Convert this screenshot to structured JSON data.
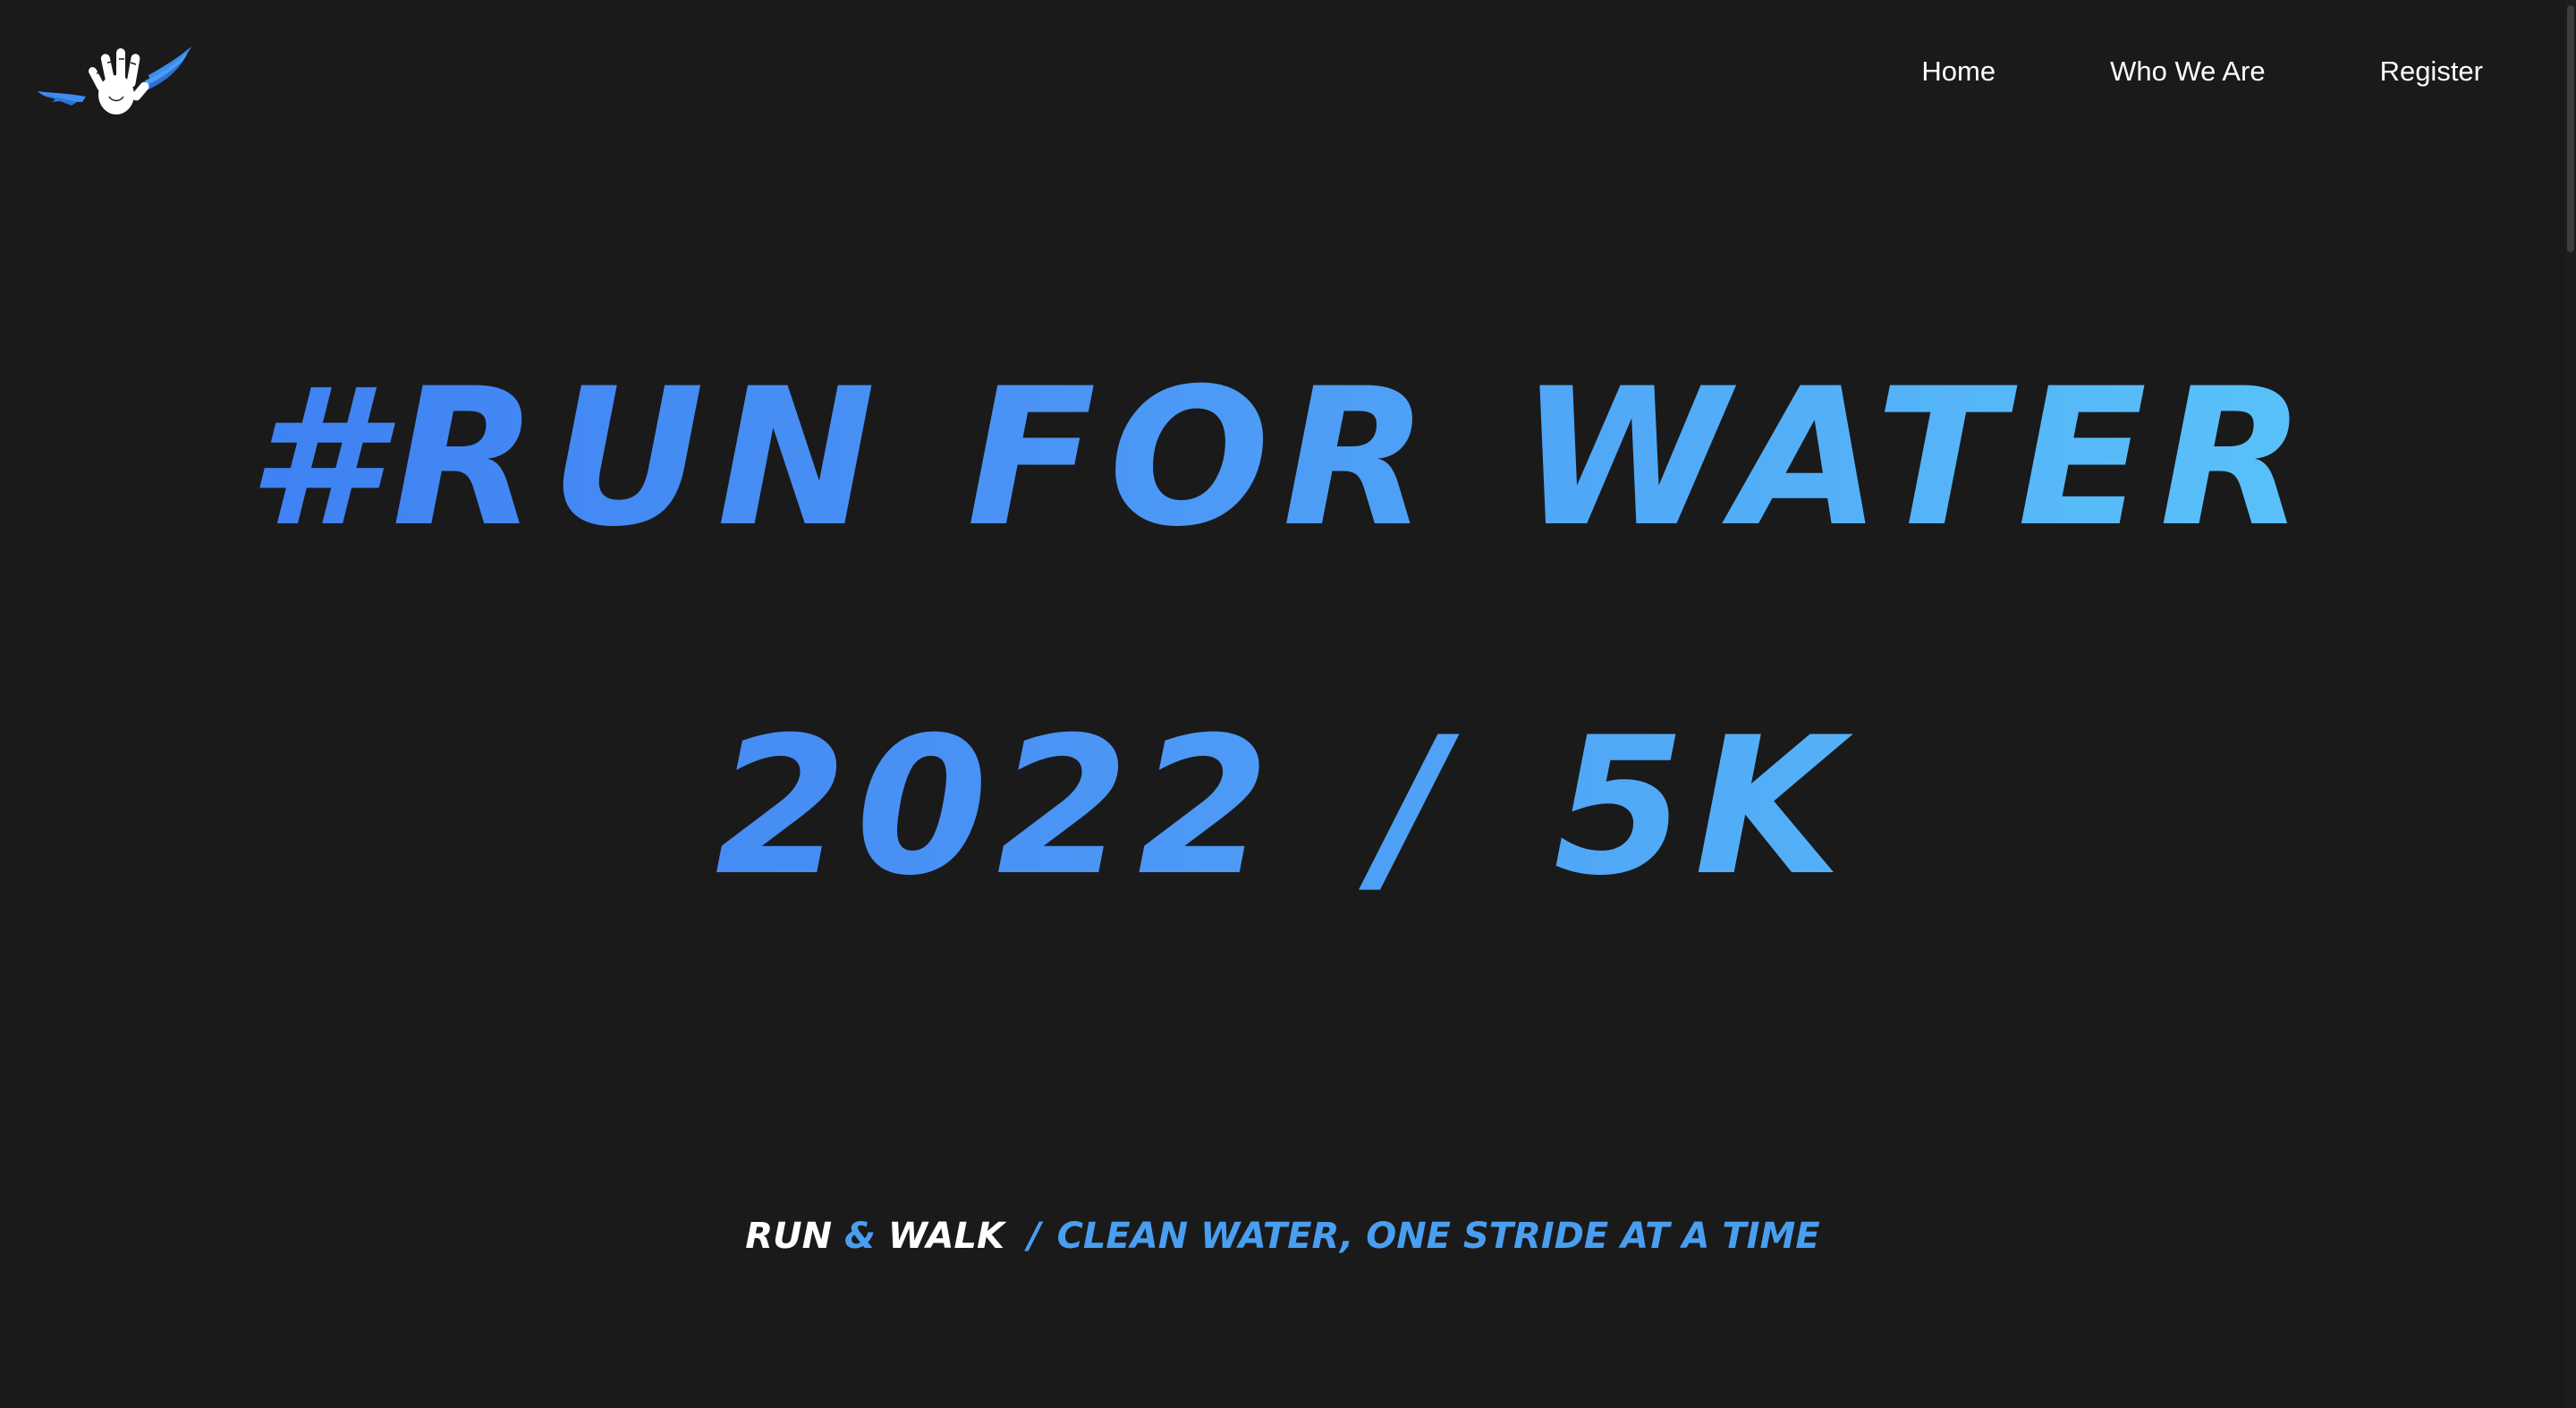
{
  "header": {
    "logo_icon": "winged-hand-logo",
    "nav": {
      "home": "Home",
      "who_we_are": "Who We Are",
      "register": "Register"
    }
  },
  "hero": {
    "title": "#RUN FOR WATER",
    "year": "2022",
    "slash": "/",
    "distance": "5K"
  },
  "tagline": {
    "run": "RUN",
    "amp": "&",
    "walk": "WALK",
    "separator": "/",
    "slogan": "CLEAN WATER, ONE STRIDE AT A TIME"
  },
  "colors": {
    "background": "#1a1a1a",
    "gradient_start": "#3b7cf2",
    "gradient_end": "#5ccbfa",
    "accent_blue": "#4a9ef0",
    "text_white": "#ffffff"
  }
}
